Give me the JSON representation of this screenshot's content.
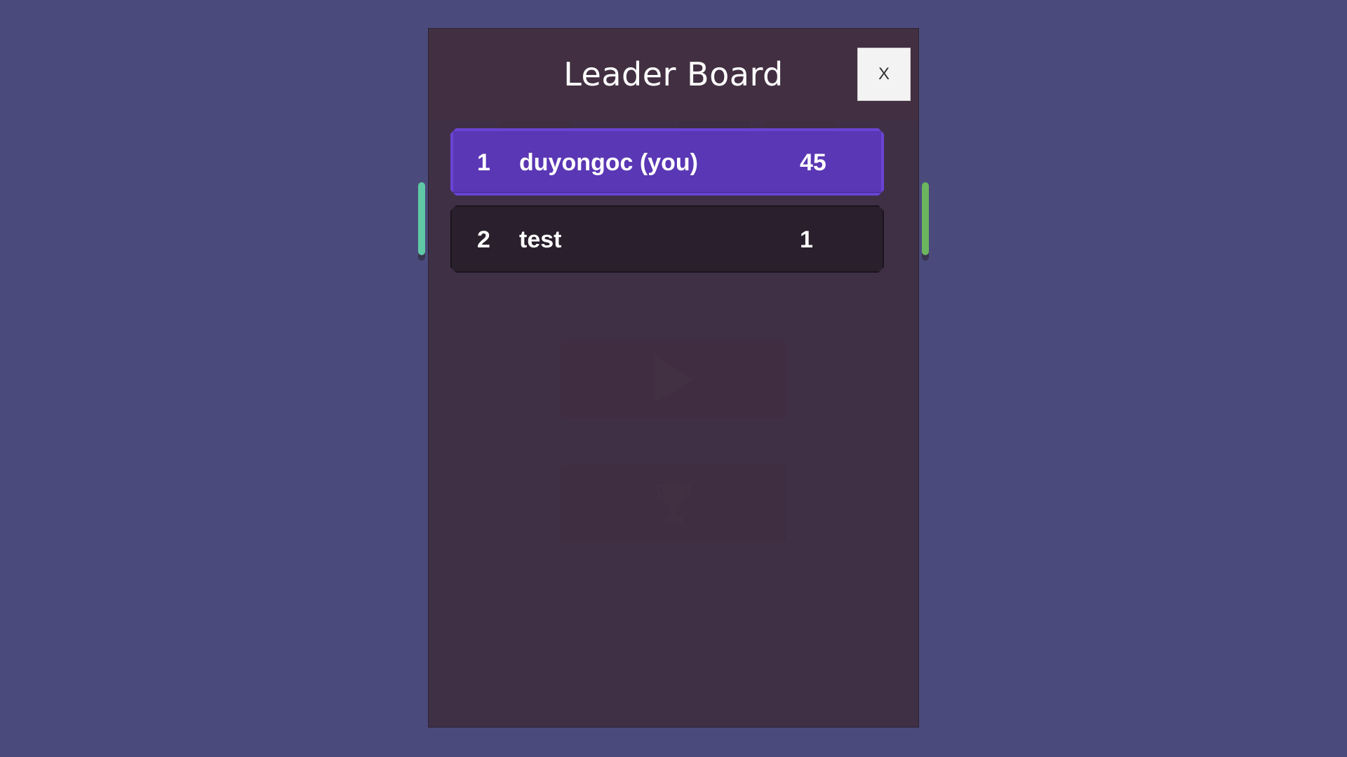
{
  "modal": {
    "title": "Leader Board",
    "close_label": "X"
  },
  "leaderboard": [
    {
      "rank": "1",
      "name": "duyongoc (you)",
      "score": "45",
      "is_you": true
    },
    {
      "rank": "2",
      "name": "test",
      "score": "1",
      "is_you": false
    }
  ],
  "colors": {
    "page_background": "#4b4a7c",
    "modal_background": "#3e2e40",
    "highlight_row": "#5a37b4",
    "row_background": "#2a1f2c",
    "close_button": "#f3f3f3"
  },
  "icons": {
    "background_play": "play-icon",
    "background_trophy": "trophy-icon"
  }
}
